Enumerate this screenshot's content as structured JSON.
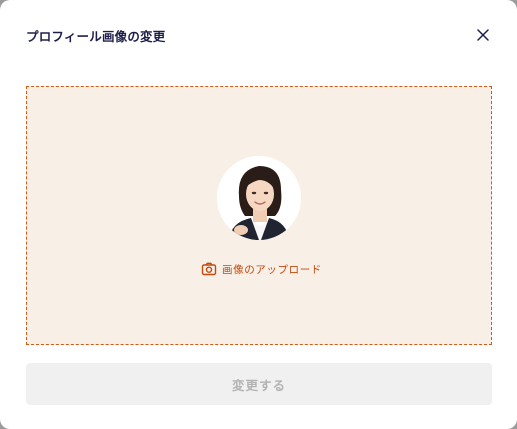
{
  "dialog": {
    "title": "プロフィール画像の変更",
    "close_icon": "close-icon"
  },
  "dropzone": {
    "avatar_alt": "profile-photo",
    "upload_label": "画像のアップロード",
    "upload_icon": "camera-icon"
  },
  "actions": {
    "submit_label": "変更する",
    "submit_disabled": true
  },
  "colors": {
    "title": "#1d1f4a",
    "accent": "#c04a0f",
    "dropzone_bg": "#f8f0e7",
    "dropzone_border": "#d25a17",
    "button_disabled_bg": "#f0f0f0",
    "button_disabled_text": "#b3b3b3"
  }
}
